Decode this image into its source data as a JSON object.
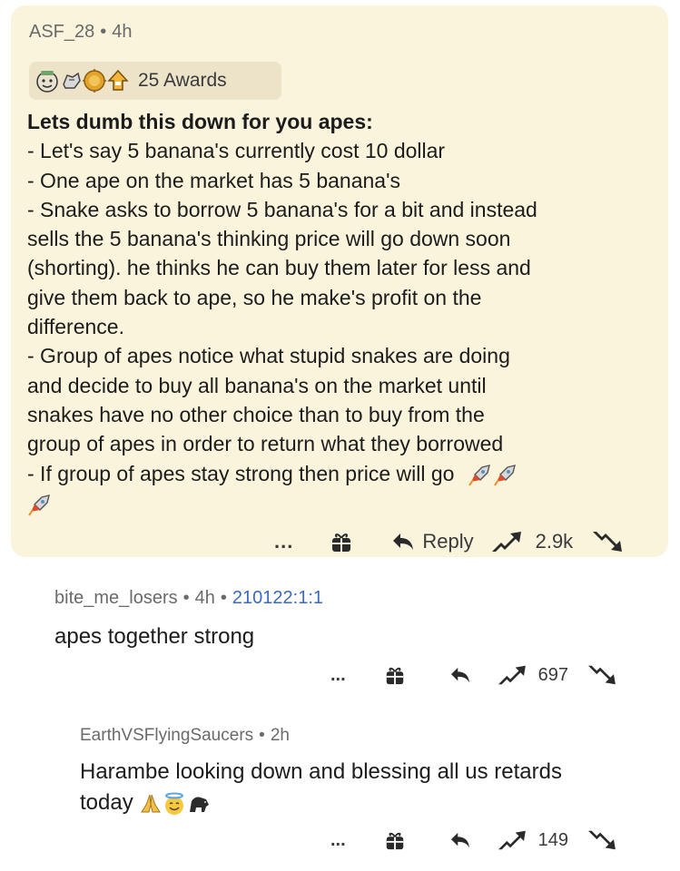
{
  "post": {
    "author": "ASF_28",
    "time": "4h",
    "awards_label": "25 Awards",
    "award_icons": [
      "gold-face-award-icon",
      "silver-hand-award-icon",
      "coin-award-icon",
      "rocket-like-award-icon"
    ],
    "heading": "Lets dumb this down for you apes:",
    "lines": [
      "- Let's say 5 banana's currently cost 10 dollar",
      "- One ape on the market has 5 banana's",
      "- Snake asks to borrow 5 banana's for a bit and instead",
      "sells the 5 banana's thinking price will go down soon",
      "(shorting). he thinks he can buy them later for less and",
      "give them back to ape, so he make's profit on the",
      "difference.",
      "- Group of apes notice what stupid snakes are doing",
      "and decide to buy all banana's on the market until",
      "snakes have no other choice than to buy from the",
      "group of apes in order to return what they borrowed",
      "- If group of apes stay strong then price will go"
    ],
    "more_label": "...",
    "reply_label": "Reply",
    "score": "2.9k",
    "card_color": "#fbf4dd"
  },
  "comments": [
    {
      "author": "bite_me_losers",
      "time": "4h",
      "flair": "210122:1:1",
      "text": "apes together strong",
      "more_label": "...",
      "score": "697"
    },
    {
      "author": "EarthVSFlyingSaucers",
      "time": "2h",
      "text_line1": "Harambe looking down and blessing all us retards",
      "text_line2": "today",
      "emoji_icons": [
        "praying-hands-icon",
        "halo-face-icon",
        "gorilla-icon"
      ],
      "more_label": "...",
      "score": "149"
    }
  ],
  "separator": "•"
}
